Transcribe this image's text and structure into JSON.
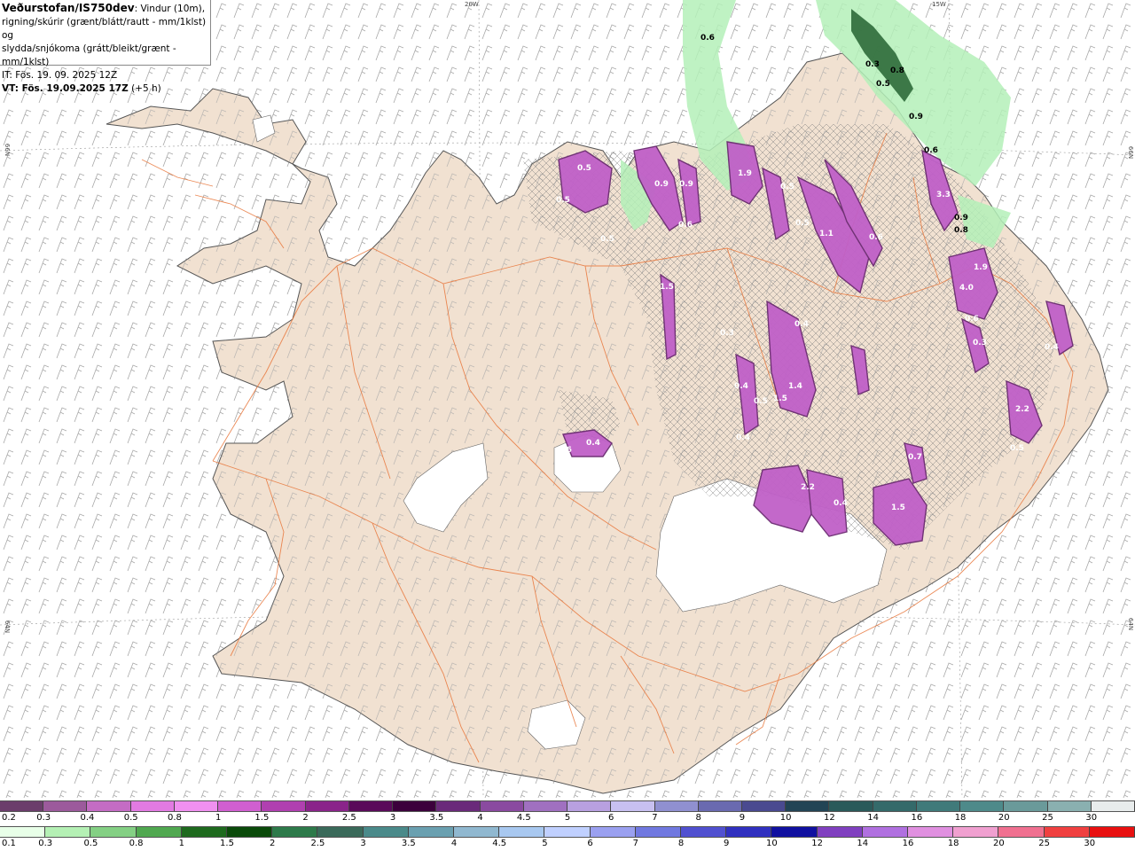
{
  "header": {
    "title": "Veðurstofan/IS750dev",
    "description_line1": ": Vindur (10m),",
    "description_line2": "rigning/skúrir (grænt/blátt/rautt - mm/1klst) og",
    "description_line3": "slydda/snjókoma (grátt/bleikt/grænt - mm/1klst)",
    "init_time": "IT: Fös. 19. 09. 2025 12Z",
    "valid_time_bold": "VT: Fös. 19.09.2025 17Z",
    "valid_time_offset": " (+5 h)"
  },
  "coordinates": {
    "lon_20w": "20W",
    "lon_15w": "15W",
    "lat_66n_left": "66N",
    "lat_66n_right": "66N",
    "lat_64n_left": "64N",
    "lat_64n_right": "64N"
  },
  "colors": {
    "land": "#f1e1d1",
    "sea": "#ffffff",
    "roads": "#e8763a",
    "coast": "#555555",
    "barbs": "#9a9a9a",
    "precip_purple": "#a040b0",
    "precip_purple_dark": "#6a2a70",
    "precip_green": "#b4f0b8",
    "precip_green_dark": "#2d6a3a"
  },
  "precip_labels": {
    "north": [
      "0.6",
      "0.3",
      "0.8",
      "0.5",
      "0.9",
      "0.6",
      "3.3",
      "0.9",
      "0.8",
      "0.5",
      "0.5",
      "0.9",
      "0.6",
      "0.5",
      "1.9",
      "0.9",
      "0.5",
      "1.1",
      "0.6",
      "0.5"
    ],
    "central": [
      "1.5",
      "1.4",
      "1.5",
      "0.4",
      "0.5",
      "0.4",
      "0.3",
      "0.4",
      "0.6",
      "0.4"
    ],
    "east": [
      "4.0",
      "1.9",
      "0.3",
      "2.2",
      "0.4",
      "0.5",
      "0.6",
      "2.2",
      "1.5",
      "0.4",
      "0.7"
    ]
  },
  "legend_snow": {
    "labels": [
      "0.2",
      "0.3",
      "0.4",
      "0.5",
      "0.8",
      "1",
      "1.5",
      "2",
      "2.5",
      "3",
      "3.5",
      "4",
      "4.5",
      "5",
      "6",
      "7",
      "8",
      "9",
      "10",
      "12",
      "14",
      "16",
      "18",
      "20",
      "25",
      "30"
    ],
    "colors": [
      "#6b3d6b",
      "#9c5a9c",
      "#c46cc4",
      "#e27ae2",
      "#f090f0",
      "#d05fd0",
      "#b040b0",
      "#8a248a",
      "#5a0a5a",
      "#3c003c",
      "#6a2a7a",
      "#8a4aa0",
      "#a070c0",
      "#b8a0e0",
      "#c8c0f0",
      "#9090d0",
      "#6a6ab0",
      "#4a4a90",
      "#224455",
      "#2a5a5a",
      "#346a6a",
      "#407a7a",
      "#4e8a8a",
      "#6a9a9a",
      "#8ab0b0",
      "#e8ecec"
    ]
  },
  "legend_rain": {
    "labels": [
      "0.1",
      "0.3",
      "0.5",
      "0.8",
      "1",
      "1.5",
      "2",
      "2.5",
      "3",
      "3.5",
      "4",
      "4.5",
      "5",
      "6",
      "7",
      "8",
      "9",
      "10",
      "12",
      "14",
      "16",
      "18",
      "20",
      "25",
      "30"
    ],
    "colors": [
      "#e8ffe8",
      "#b4f0b4",
      "#84d084",
      "#50a850",
      "#1e6a1e",
      "#0a4a0a",
      "#2d7a4a",
      "#3a6a5a",
      "#4a8a8a",
      "#6aa0b0",
      "#90b8d0",
      "#a8c8f0",
      "#c0d0ff",
      "#9aa0f0",
      "#7078e0",
      "#5050d0",
      "#3030c0",
      "#1010a0",
      "#8040c0",
      "#b070e0",
      "#e090e0",
      "#f0a0d0",
      "#f07090",
      "#f04040",
      "#e81010"
    ]
  }
}
